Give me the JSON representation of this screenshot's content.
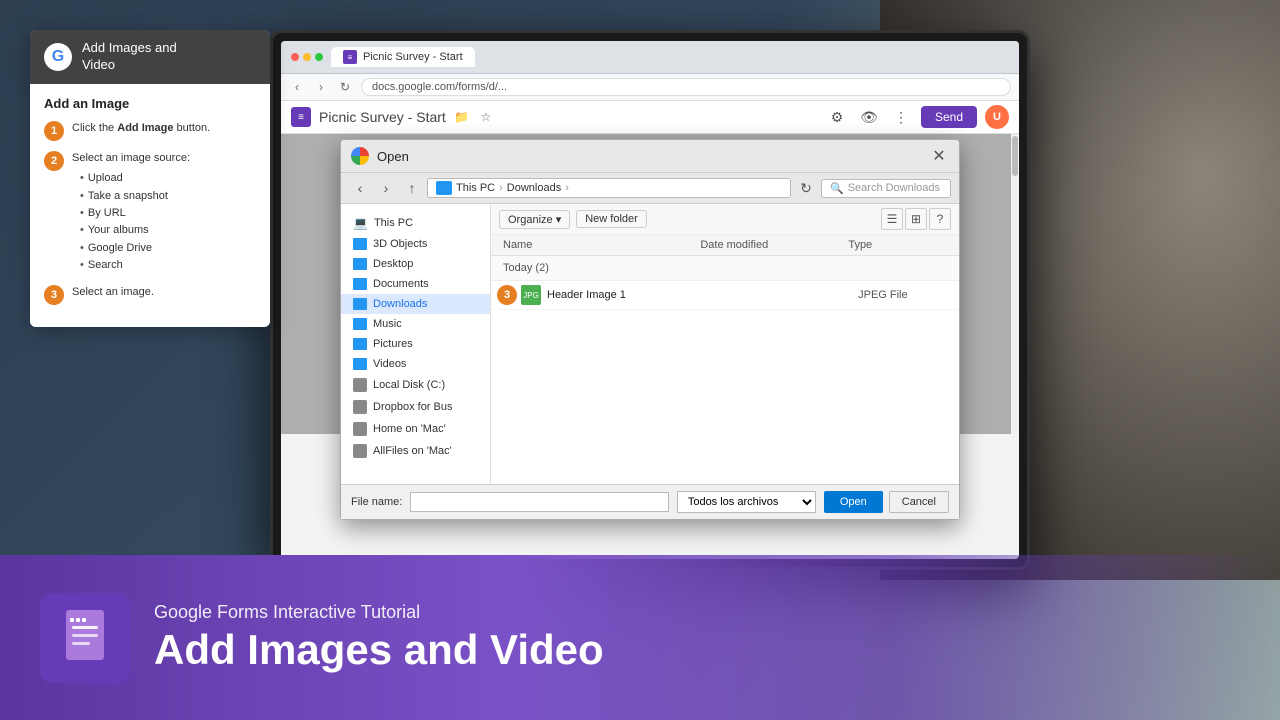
{
  "background": {
    "color": "#2c3e50"
  },
  "tutorial_panel": {
    "header_title": "Add Images and\nVideo",
    "g_letter": "G",
    "section_title": "Add an Image",
    "steps": [
      {
        "number": "1",
        "text": "Click the ",
        "bold": "Add Image",
        "text2": " button."
      },
      {
        "number": "2",
        "text": "Select an image source:",
        "bullets": [
          "Upload",
          "Take a snapshot",
          "By URL",
          "Your albums",
          "Google Drive",
          "Search"
        ]
      },
      {
        "number": "3",
        "text": "Select an image."
      }
    ]
  },
  "browser": {
    "tab_title": "Picnic Survey - Start",
    "url_text": "docs.google.com/forms/d/...",
    "send_label": "Send"
  },
  "dialog": {
    "title": "Open",
    "close_btn": "✕",
    "nav": {
      "back": "‹",
      "forward": "›",
      "up": "↑",
      "breadcrumb": [
        "This PC",
        "Downloads"
      ],
      "search_placeholder": "Search Downloads",
      "refresh": "↻"
    },
    "toolbar": {
      "organize": "Organize ▾",
      "new_folder": "New folder"
    },
    "columns": {
      "name": "Name",
      "modified": "Date modified",
      "type": "Type"
    },
    "group_label": "Today (2)",
    "files": [
      {
        "name": "Header Image 1",
        "type": "JPEG File",
        "icon": "jpeg"
      }
    ],
    "footer": {
      "file_name_label": "File name:",
      "filetype": "Todos los archivos",
      "open_btn": "Open",
      "cancel_btn": "Cancel"
    },
    "sidebar_items": [
      {
        "label": "This PC",
        "icon": "computer",
        "active": false
      },
      {
        "label": "3D Objects",
        "icon": "folder",
        "active": false
      },
      {
        "label": "Desktop",
        "icon": "folder",
        "active": false
      },
      {
        "label": "Documents",
        "icon": "folder",
        "active": false
      },
      {
        "label": "Downloads",
        "icon": "folder",
        "active": true
      },
      {
        "label": "Music",
        "icon": "folder",
        "active": false
      },
      {
        "label": "Pictures",
        "icon": "folder",
        "active": false
      },
      {
        "label": "Videos",
        "icon": "folder",
        "active": false
      },
      {
        "label": "Local Disk (C:)",
        "icon": "drive",
        "active": false
      },
      {
        "label": "Dropbox for Bus",
        "icon": "drive",
        "active": false
      },
      {
        "label": "Home on 'Mac'",
        "icon": "drive",
        "active": false
      },
      {
        "label": "AllFiles on 'Mac'",
        "icon": "drive",
        "active": false
      }
    ]
  },
  "step3_badge": "3",
  "bottom_bar": {
    "subtitle": "Google Forms Interactive Tutorial",
    "title": "Add Images and Video"
  }
}
